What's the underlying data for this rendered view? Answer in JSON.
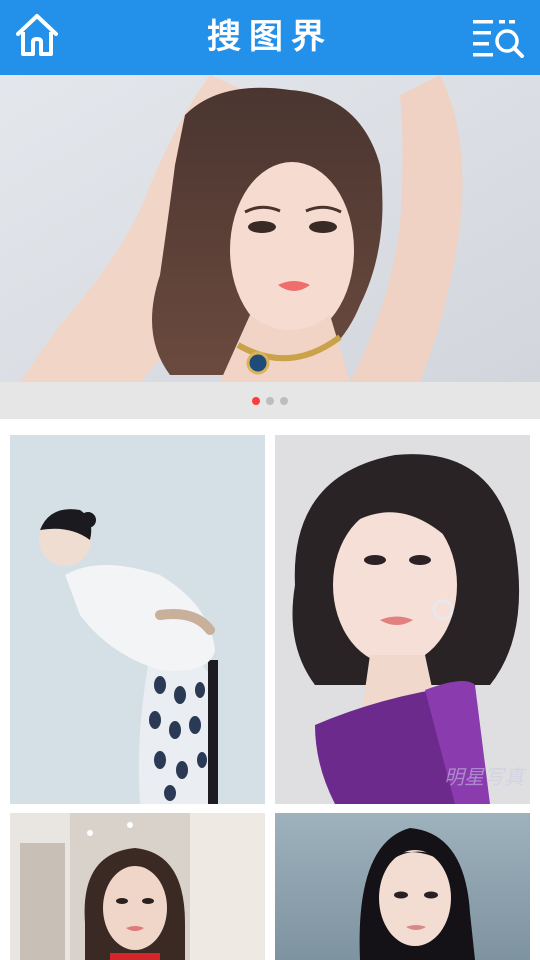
{
  "header": {
    "title": "搜图界",
    "home_icon": "home-icon",
    "menu_icon": "search-list-icon",
    "background": "#2391ea"
  },
  "banner": {
    "image": "portrait-woman-necklace",
    "slides": 3,
    "active_slide": 1,
    "active_dot_color": "#ff3b3b"
  },
  "grid": {
    "items": [
      {
        "image": "woman-bending-white-blouse"
      },
      {
        "image": "woman-bob-purple-dress",
        "watermark": "明星写真"
      },
      {
        "image": "woman-red-top-room"
      },
      {
        "image": "woman-long-black-hair"
      }
    ]
  }
}
